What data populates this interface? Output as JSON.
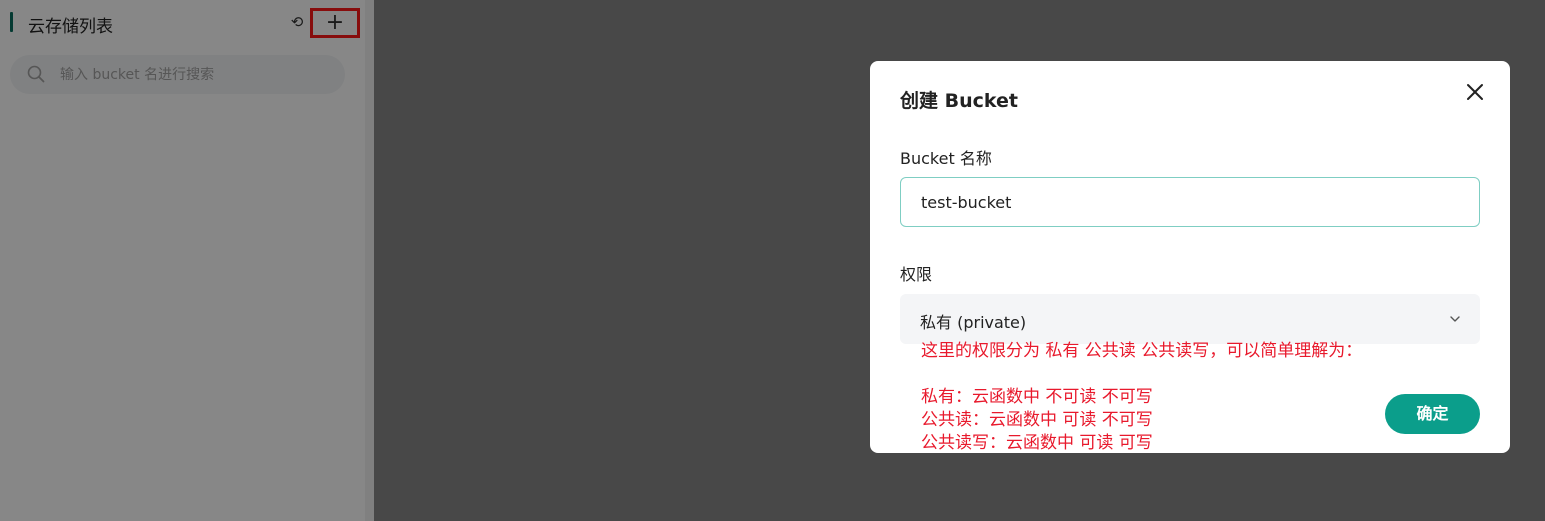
{
  "sidebar": {
    "title": "云存储列表",
    "refresh_glyph": "⟲",
    "add_glyph": "+",
    "search": {
      "placeholder": "输入 bucket 名进行搜索",
      "value": ""
    }
  },
  "dialog": {
    "title": "创建 Bucket",
    "name_label": "Bucket 名称",
    "name_value": "test-bucket",
    "permission_label": "权限",
    "permission_selected": "私有 (private)",
    "confirm_label": "确定"
  },
  "annotation": {
    "line1": "这里的权限分为 私有 公共读  公共读写，可以简单理解为：",
    "line2": "私有：云函数中 不可读 不可写",
    "line3": "公共读：云函数中 可读 不可写",
    "line4": "公共读写：云函数中 可读 可写"
  },
  "colors": {
    "accent": "#0a6e5f",
    "confirm_button": "#0b9e8b",
    "highlight_box": "#ff1a1a",
    "annotation_text": "#e8192c",
    "input_border": "#7fcec3"
  },
  "icons": {
    "refresh": "refresh-icon",
    "add": "plus-icon",
    "search": "search-icon",
    "close": "close-icon",
    "chevron": "chevron-down-icon"
  }
}
